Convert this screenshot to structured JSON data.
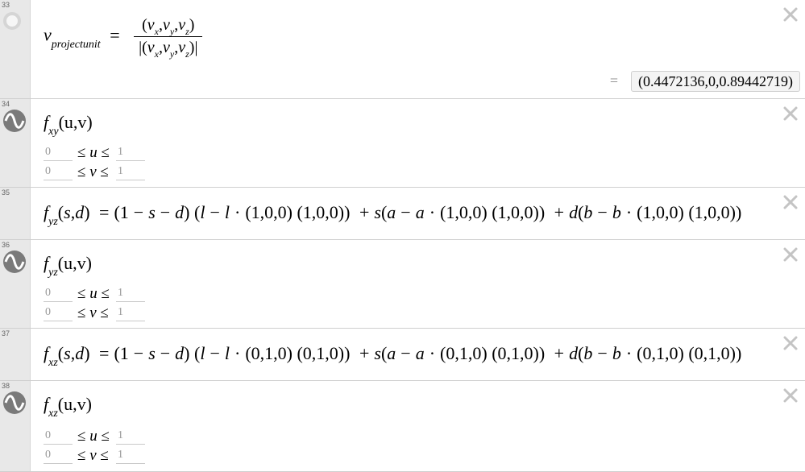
{
  "rows": [
    {
      "number": "33",
      "icon": "empty-circle-icon",
      "lhs_main": "v",
      "lhs_sub": "projectunit",
      "numerator": [
        "v",
        "x",
        "v",
        "y",
        "v",
        "z"
      ],
      "result": "(0.4472136,0,0.89442719)"
    },
    {
      "number": "34",
      "icon": "surface-icon",
      "func": "f",
      "func_sub": "xy",
      "args": "(u,v)",
      "ranges": [
        {
          "min": "0",
          "var": "u",
          "max": "1"
        },
        {
          "min": "0",
          "var": "v",
          "max": "1"
        }
      ]
    },
    {
      "number": "35",
      "func": "f",
      "func_sub": "yz",
      "vec": "(1,0,0)"
    },
    {
      "number": "36",
      "icon": "surface-icon",
      "func": "f",
      "func_sub": "yz",
      "args": "(u,v)",
      "ranges": [
        {
          "min": "0",
          "var": "u",
          "max": "1"
        },
        {
          "min": "0",
          "var": "v",
          "max": "1"
        }
      ]
    },
    {
      "number": "37",
      "func": "f",
      "func_sub": "xz",
      "vec": "(0,1,0)"
    },
    {
      "number": "38",
      "icon": "surface-icon",
      "func": "f",
      "func_sub": "xz",
      "args": "(u,v)",
      "ranges": [
        {
          "min": "0",
          "var": "u",
          "max": "1"
        },
        {
          "min": "0",
          "var": "v",
          "max": "1"
        }
      ]
    }
  ],
  "colors": {
    "gutter": "#e8e8e8",
    "icon": "#7a7a7a",
    "close": "#c4c4c4"
  }
}
